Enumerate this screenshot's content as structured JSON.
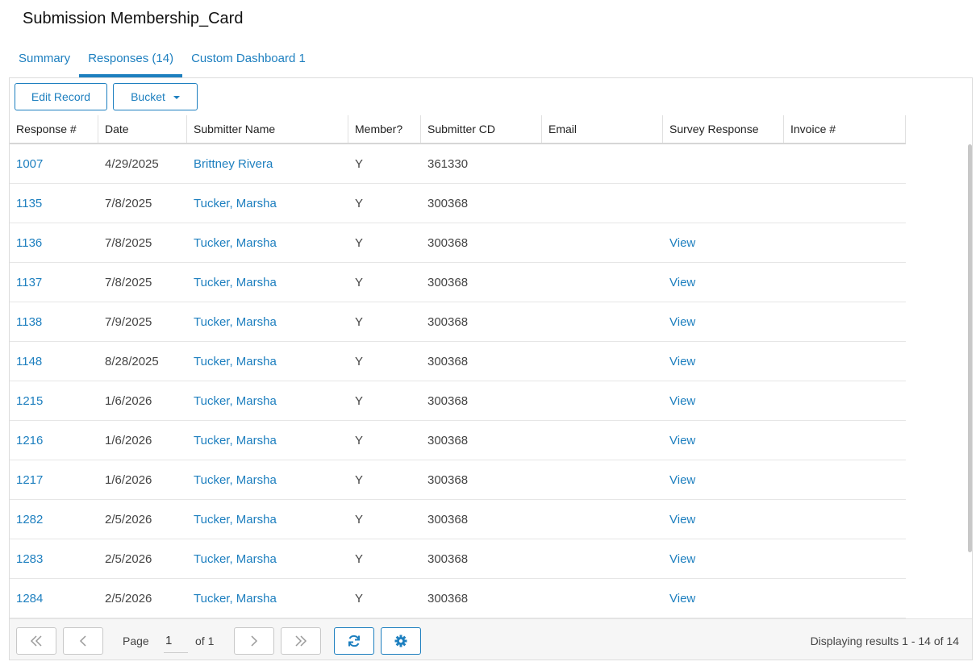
{
  "page": {
    "title": "Submission Membership_Card"
  },
  "tabs": [
    {
      "label": "Summary",
      "active": false
    },
    {
      "label": "Responses (14)",
      "active": true
    },
    {
      "label": "Custom Dashboard 1",
      "active": false
    }
  ],
  "toolbar": {
    "edit_label": "Edit Record",
    "bucket_label": "Bucket"
  },
  "columns": [
    "Response #",
    "Date",
    "Submitter Name",
    "Member?",
    "Submitter CD",
    "Email",
    "Survey Response",
    "Invoice #"
  ],
  "rows": [
    {
      "id": "1007",
      "date": "4/29/2025",
      "name": "Brittney Rivera",
      "member": "Y",
      "cd": "361330",
      "email": "",
      "survey": "",
      "invoice": ""
    },
    {
      "id": "1135",
      "date": "7/8/2025",
      "name": "Tucker, Marsha",
      "member": "Y",
      "cd": "300368",
      "email": "",
      "survey": "",
      "invoice": ""
    },
    {
      "id": "1136",
      "date": "7/8/2025",
      "name": "Tucker, Marsha",
      "member": "Y",
      "cd": "300368",
      "email": "",
      "survey": "View",
      "invoice": ""
    },
    {
      "id": "1137",
      "date": "7/8/2025",
      "name": "Tucker, Marsha",
      "member": "Y",
      "cd": "300368",
      "email": "",
      "survey": "View",
      "invoice": ""
    },
    {
      "id": "1138",
      "date": "7/9/2025",
      "name": "Tucker, Marsha",
      "member": "Y",
      "cd": "300368",
      "email": "",
      "survey": "View",
      "invoice": ""
    },
    {
      "id": "1148",
      "date": "8/28/2025",
      "name": "Tucker, Marsha",
      "member": "Y",
      "cd": "300368",
      "email": "",
      "survey": "View",
      "invoice": ""
    },
    {
      "id": "1215",
      "date": "1/6/2026",
      "name": "Tucker, Marsha",
      "member": "Y",
      "cd": "300368",
      "email": "",
      "survey": "View",
      "invoice": ""
    },
    {
      "id": "1216",
      "date": "1/6/2026",
      "name": "Tucker, Marsha",
      "member": "Y",
      "cd": "300368",
      "email": "",
      "survey": "View",
      "invoice": ""
    },
    {
      "id": "1217",
      "date": "1/6/2026",
      "name": "Tucker, Marsha",
      "member": "Y",
      "cd": "300368",
      "email": "",
      "survey": "View",
      "invoice": ""
    },
    {
      "id": "1282",
      "date": "2/5/2026",
      "name": "Tucker, Marsha",
      "member": "Y",
      "cd": "300368",
      "email": "",
      "survey": "View",
      "invoice": ""
    },
    {
      "id": "1283",
      "date": "2/5/2026",
      "name": "Tucker, Marsha",
      "member": "Y",
      "cd": "300368",
      "email": "",
      "survey": "View",
      "invoice": ""
    },
    {
      "id": "1284",
      "date": "2/5/2026",
      "name": "Tucker, Marsha",
      "member": "Y",
      "cd": "300368",
      "email": "",
      "survey": "View",
      "invoice": ""
    }
  ],
  "pager": {
    "page_label": "Page",
    "page_value": "1",
    "of_label": "of 1",
    "summary": "Displaying results 1 - 14 of 14",
    "icons": [
      "first-page-icon",
      "previous-page-icon",
      "next-page-icon",
      "last-page-icon",
      "refresh-icon",
      "gear-icon"
    ]
  },
  "colors": {
    "accent": "#1d7fbf",
    "border": "#dcdcdc",
    "pager_bg": "#f6f6f6"
  }
}
